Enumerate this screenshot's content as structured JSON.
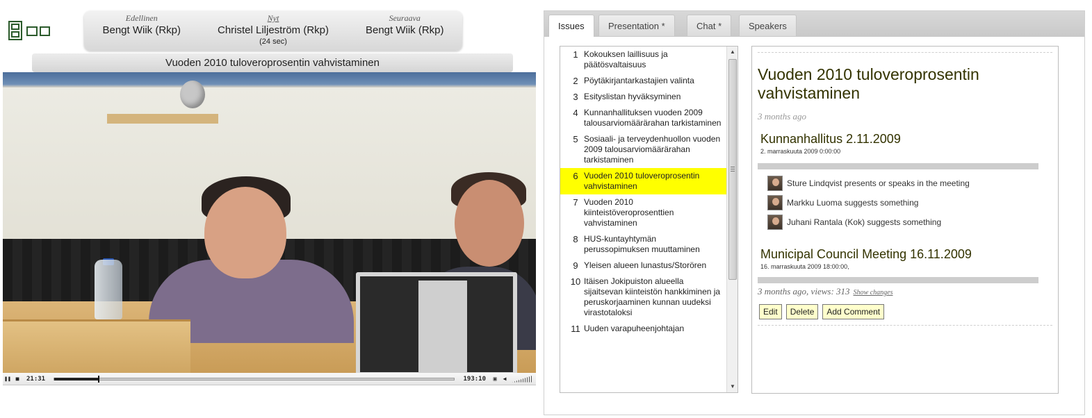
{
  "speakers": {
    "previous": {
      "caption": "Edellinen",
      "name": "Bengt Wiik (Rkp)"
    },
    "current": {
      "caption": "Nyt",
      "name": "Christel Liljeström (Rkp)",
      "duration": "(24 sec)"
    },
    "next": {
      "caption": "Seuraava",
      "name": "Bengt Wiik (Rkp)"
    }
  },
  "current_issue_banner": "Vuoden 2010 tuloveroprosentin vahvistaminen",
  "player": {
    "elapsed": "21:31",
    "total": "193:10",
    "progress_fraction": 0.11
  },
  "tabs": [
    {
      "label": "Issues",
      "active": true
    },
    {
      "label": "Presentation *",
      "active": false
    },
    {
      "label": "Chat *",
      "active": false
    },
    {
      "label": "Speakers",
      "active": false
    }
  ],
  "issues": [
    {
      "num": "1",
      "title": "Kokouksen laillisuus ja päätösvaltaisuus",
      "selected": false
    },
    {
      "num": "2",
      "title": "Pöytäkirjantarkastajien valinta",
      "selected": false
    },
    {
      "num": "3",
      "title": "Esityslistan hyväksyminen",
      "selected": false
    },
    {
      "num": "4",
      "title": "Kunnanhallituksen vuoden 2009 talousarviomäärärahan tarkistaminen",
      "selected": false
    },
    {
      "num": "5",
      "title": "Sosiaali- ja terveydenhuollon vuoden 2009 talousarviomäärärahan tarkistaminen",
      "selected": false
    },
    {
      "num": "6",
      "title": "Vuoden 2010 tuloveroprosentin vahvistaminen",
      "selected": true
    },
    {
      "num": "7",
      "title": "Vuoden 2010 kiinteistöveroprosenttien vahvistaminen",
      "selected": false
    },
    {
      "num": "8",
      "title": "HUS-kuntayhtymän perussopimuksen muuttaminen",
      "selected": false
    },
    {
      "num": "9",
      "title": "Yleisen alueen lunastus/Storören",
      "selected": false
    },
    {
      "num": "10",
      "title": "Itäisen Jokipuiston alueella sijaitsevan kiinteistön hankkiminen ja peruskorjaaminen kunnan uudeksi virastotaloksi",
      "selected": false
    },
    {
      "num": "11",
      "title": "Uuden varapuheenjohtajan",
      "selected": false
    }
  ],
  "detail": {
    "title": "Vuoden 2010 tuloveroprosentin vahvistaminen",
    "ago": "3 months ago",
    "meetings": [
      {
        "title": "Kunnanhallitus 2.11.2009",
        "date": "2. marraskuuta 2009 0:00:00",
        "events": [
          {
            "icon": "avatar-sture-lindqvist",
            "text": "Sture Lindqvist presents or speaks in the meeting"
          },
          {
            "icon": "avatar-markku-luoma",
            "text": "Markku Luoma suggests something"
          },
          {
            "icon": "avatar-juhani-rantala",
            "text": "Juhani Rantala (Kok) suggests something"
          }
        ]
      },
      {
        "title": "Municipal Council Meeting 16.11.2009",
        "date": "16. marraskuuta 2009 18:00:00,",
        "events": []
      }
    ],
    "meta": "3 months ago, views: 313",
    "show_changes": "Show changes",
    "buttons": {
      "edit": "Edit",
      "delete": "Delete",
      "add_comment": "Add Comment"
    }
  },
  "colors": {
    "selected_issue": "#ffff00",
    "heading": "#333300",
    "action_button_bg": "#ffffcc"
  }
}
